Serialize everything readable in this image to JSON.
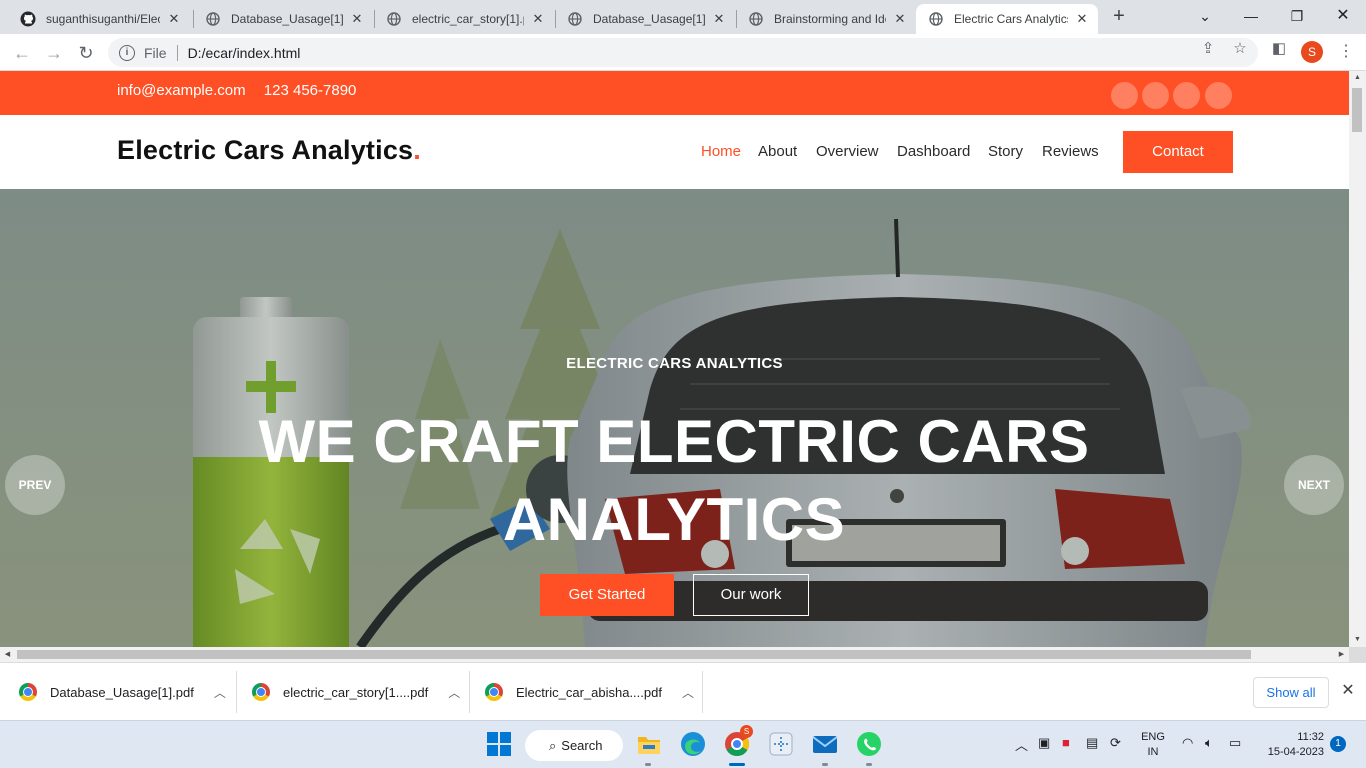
{
  "browser": {
    "tabs": [
      {
        "label": "suganthisuganthi/Elec",
        "icon": "github-icon",
        "active": false
      },
      {
        "label": "Database_Uasage[1].p",
        "icon": "globe-icon",
        "active": false
      },
      {
        "label": "electric_car_story[1].p",
        "icon": "globe-icon",
        "active": false
      },
      {
        "label": "Database_Uasage[1].p",
        "icon": "globe-icon",
        "active": false
      },
      {
        "label": "Brainstorming and Ide",
        "icon": "globe-icon",
        "active": false
      },
      {
        "label": "Electric Cars Analytics",
        "icon": "globe-icon",
        "active": true
      }
    ],
    "address": {
      "scheme_label": "File",
      "url": "D:/ecar/index.html"
    },
    "profile_initial": "S"
  },
  "site": {
    "topbar": {
      "email": "info@example.com",
      "phone": "123 456-7890"
    },
    "brand": {
      "name": "Electric Cars Analytics",
      "dot": "."
    },
    "nav": [
      {
        "label": "Home",
        "active": true
      },
      {
        "label": "About",
        "active": false
      },
      {
        "label": "Overview",
        "active": false
      },
      {
        "label": "Dashboard",
        "active": false
      },
      {
        "label": "Story",
        "active": false
      },
      {
        "label": "Reviews",
        "active": false
      }
    ],
    "contact_button": "Contact",
    "hero": {
      "eyebrow": "ELECTRIC CARS ANALYTICS",
      "title": "WE CRAFT ELECTRIC CARS ANALYTICS",
      "primary_cta": "Get Started",
      "secondary_cta": "Our work",
      "prev_label": "PREV",
      "next_label": "NEXT"
    }
  },
  "downloads": {
    "items": [
      {
        "name": "Database_Uasage[1].pdf"
      },
      {
        "name": "electric_car_story[1....pdf"
      },
      {
        "name": "Electric_car_abisha....pdf"
      }
    ],
    "show_all": "Show all"
  },
  "taskbar": {
    "search_label": "Search",
    "language": {
      "line1": "ENG",
      "line2": "IN"
    },
    "clock": {
      "time": "11:32",
      "date": "15-04-2023"
    },
    "notifications": "1",
    "chrome_badge": "S"
  },
  "colors": {
    "accent": "#ff4f24",
    "chrome_tabstrip": "#dee1e6",
    "taskbar": "#dfe7f3"
  }
}
